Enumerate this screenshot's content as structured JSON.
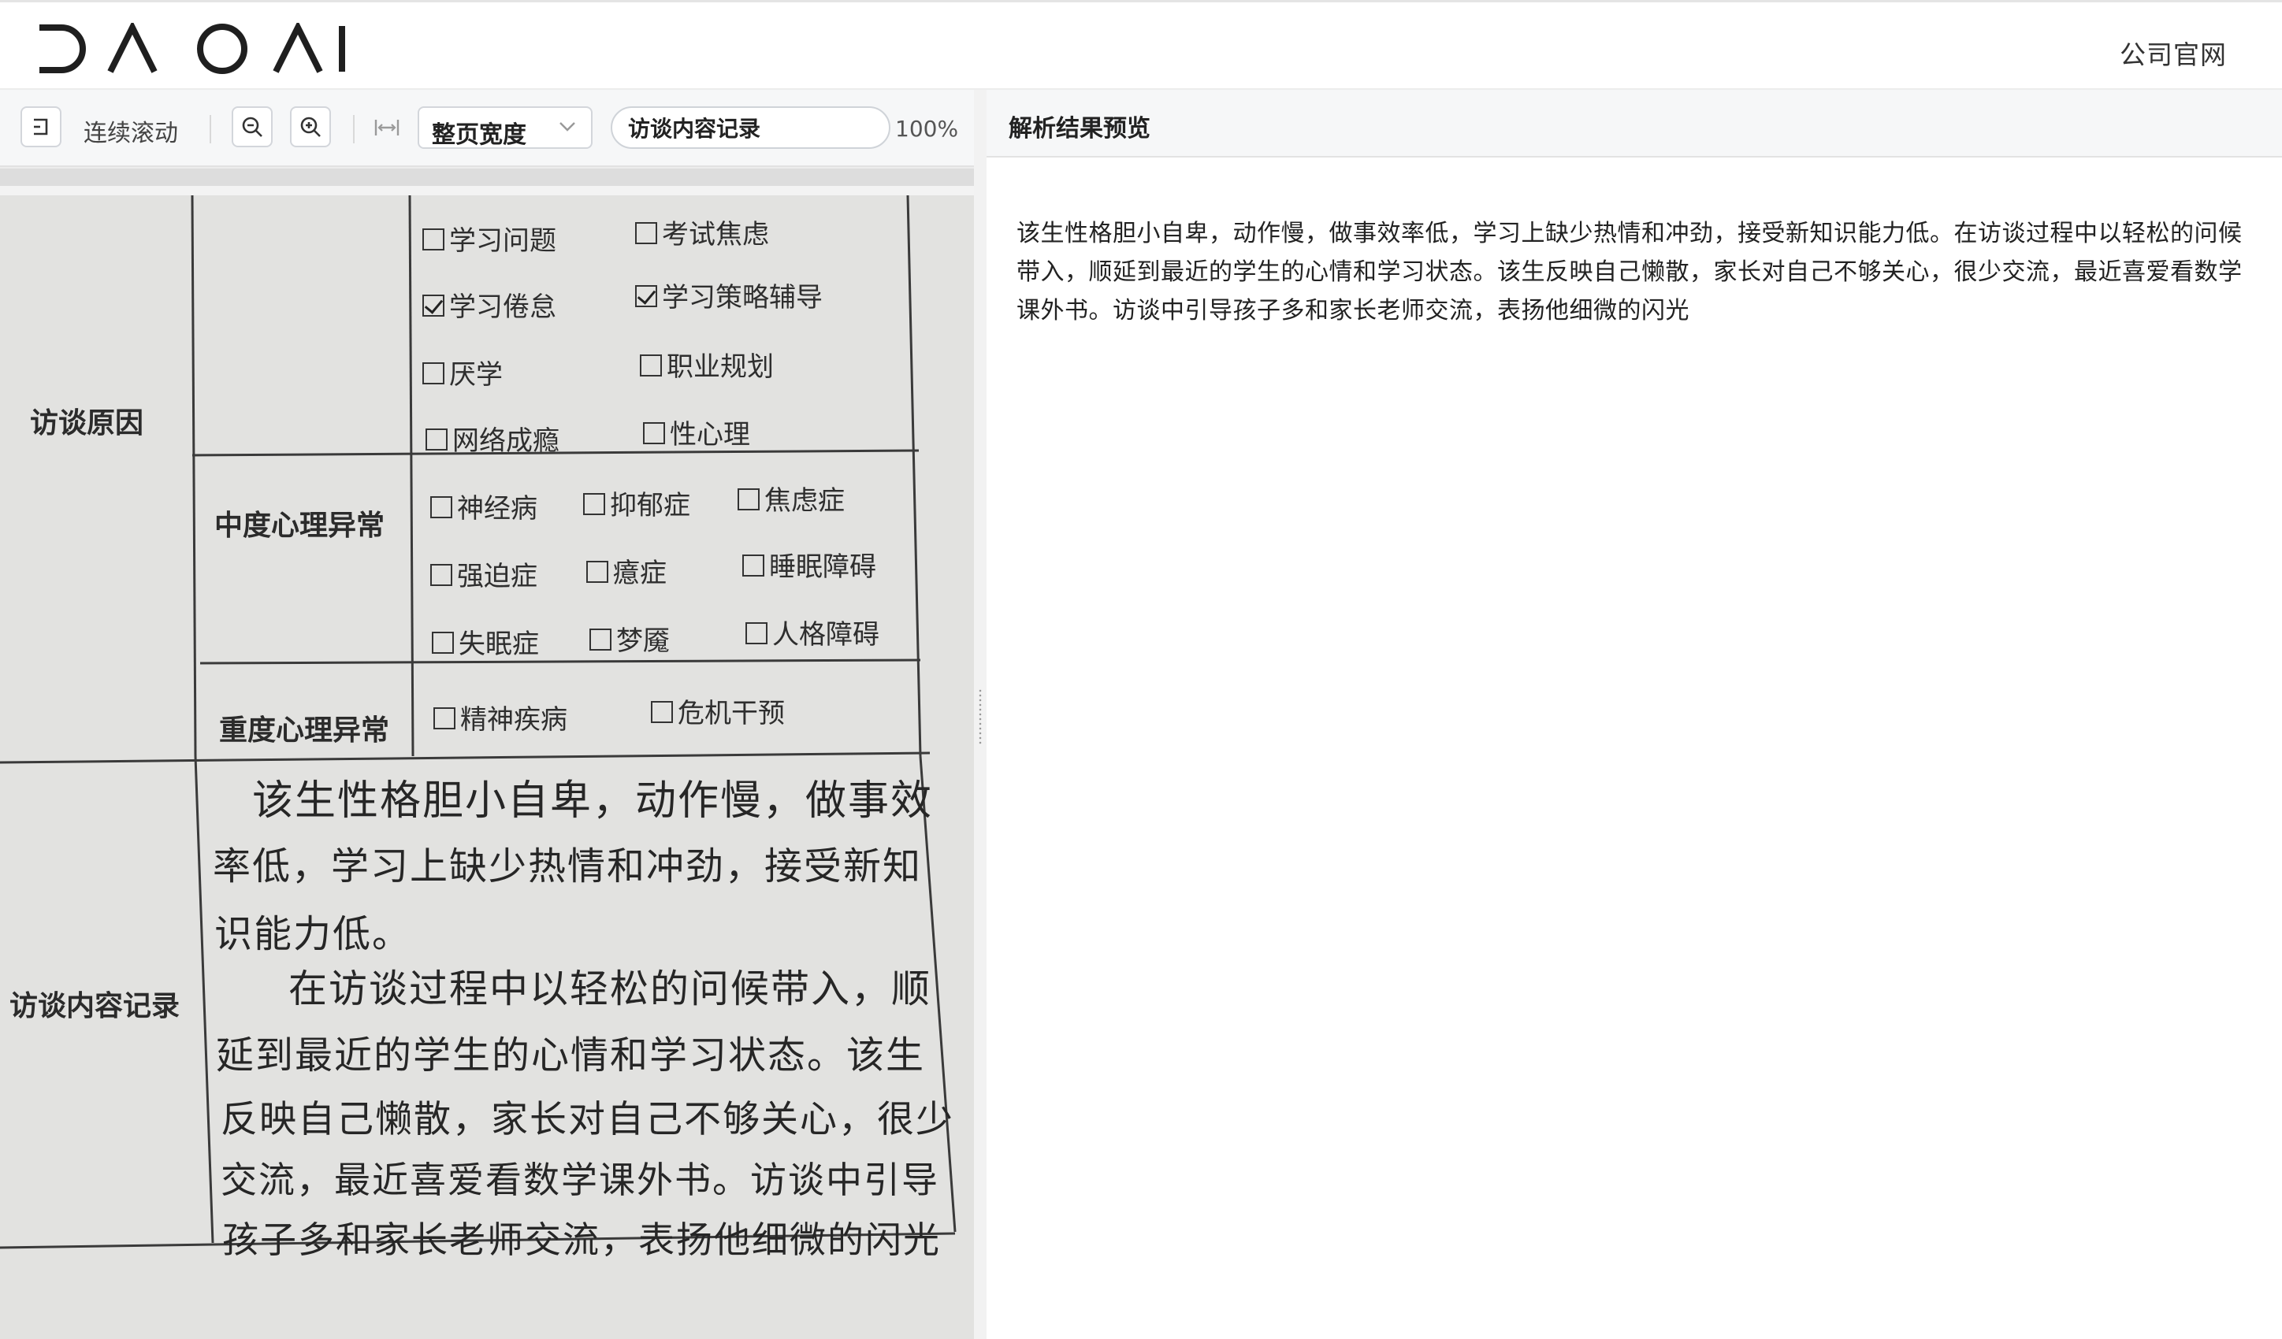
{
  "header": {
    "logo_text": "DAOAI",
    "official_site_link": "公司官网"
  },
  "toolbar": {
    "back_icon": "exit-icon",
    "continuous_scroll_label": "连续滚动",
    "zoom_out_icon": "zoom-out-icon",
    "zoom_in_icon": "zoom-in-icon",
    "fit_width_icon": "fit-width-icon",
    "fit_mode_value": "整页宽度",
    "document_field_value": "访谈内容记录",
    "zoom_level": "100%"
  },
  "document": {
    "section_reason_label": "访谈原因",
    "section_moderate_label": "中度心理异常",
    "section_severe_label": "重度心理异常",
    "section_record_label": "访谈内容记录",
    "reason_options": [
      {
        "label": "学习问题",
        "checked": false
      },
      {
        "label": "考试焦虑",
        "checked": false
      },
      {
        "label": "学习倦怠",
        "checked": true
      },
      {
        "label": "学习策略辅导",
        "checked": true
      },
      {
        "label": "厌学",
        "checked": false
      },
      {
        "label": "职业规划",
        "checked": false
      },
      {
        "label": "网络成瘾",
        "checked": false
      },
      {
        "label": "性心理",
        "checked": false
      }
    ],
    "moderate_options": [
      {
        "label": "神经病",
        "checked": false
      },
      {
        "label": "抑郁症",
        "checked": false
      },
      {
        "label": "焦虑症",
        "checked": false
      },
      {
        "label": "强迫症",
        "checked": false
      },
      {
        "label": "癔症",
        "checked": false
      },
      {
        "label": "睡眠障碍",
        "checked": false
      },
      {
        "label": "失眠症",
        "checked": false
      },
      {
        "label": "梦魇",
        "checked": false
      },
      {
        "label": "人格障碍",
        "checked": false
      }
    ],
    "severe_options": [
      {
        "label": "精神疾病",
        "checked": false
      },
      {
        "label": "危机干预",
        "checked": false
      }
    ],
    "handwritten_lines": [
      "该生性格胆小自卑，动作慢，做事效",
      "率低，学习上缺少热情和冲劲，接受新知",
      "识能力低。",
      "在访谈过程中以轻松的问候带入，顺",
      "延到最近的学生的心情和学习状态。该生",
      "反映自己懒散，家长对自己不够关心，很少",
      "交流，最近喜爱看数学课外书。访谈中引导",
      "孩子多和家长老师交流，表扬他细微的闪光"
    ]
  },
  "result_panel": {
    "title": "解析结果预览",
    "text": "该生性格胆小自卑，动作慢，做事效率低，学习上缺少热情和冲劲，接受新知识能力低。在访谈过程中以轻松的问候带入，顺延到最近的学生的心情和学习状态。该生反映自己懒散，家长对自己不够关心，很少交流，最近喜爱看数学课外书。访谈中引导孩子多和家长老师交流，表扬他细微的闪光"
  }
}
